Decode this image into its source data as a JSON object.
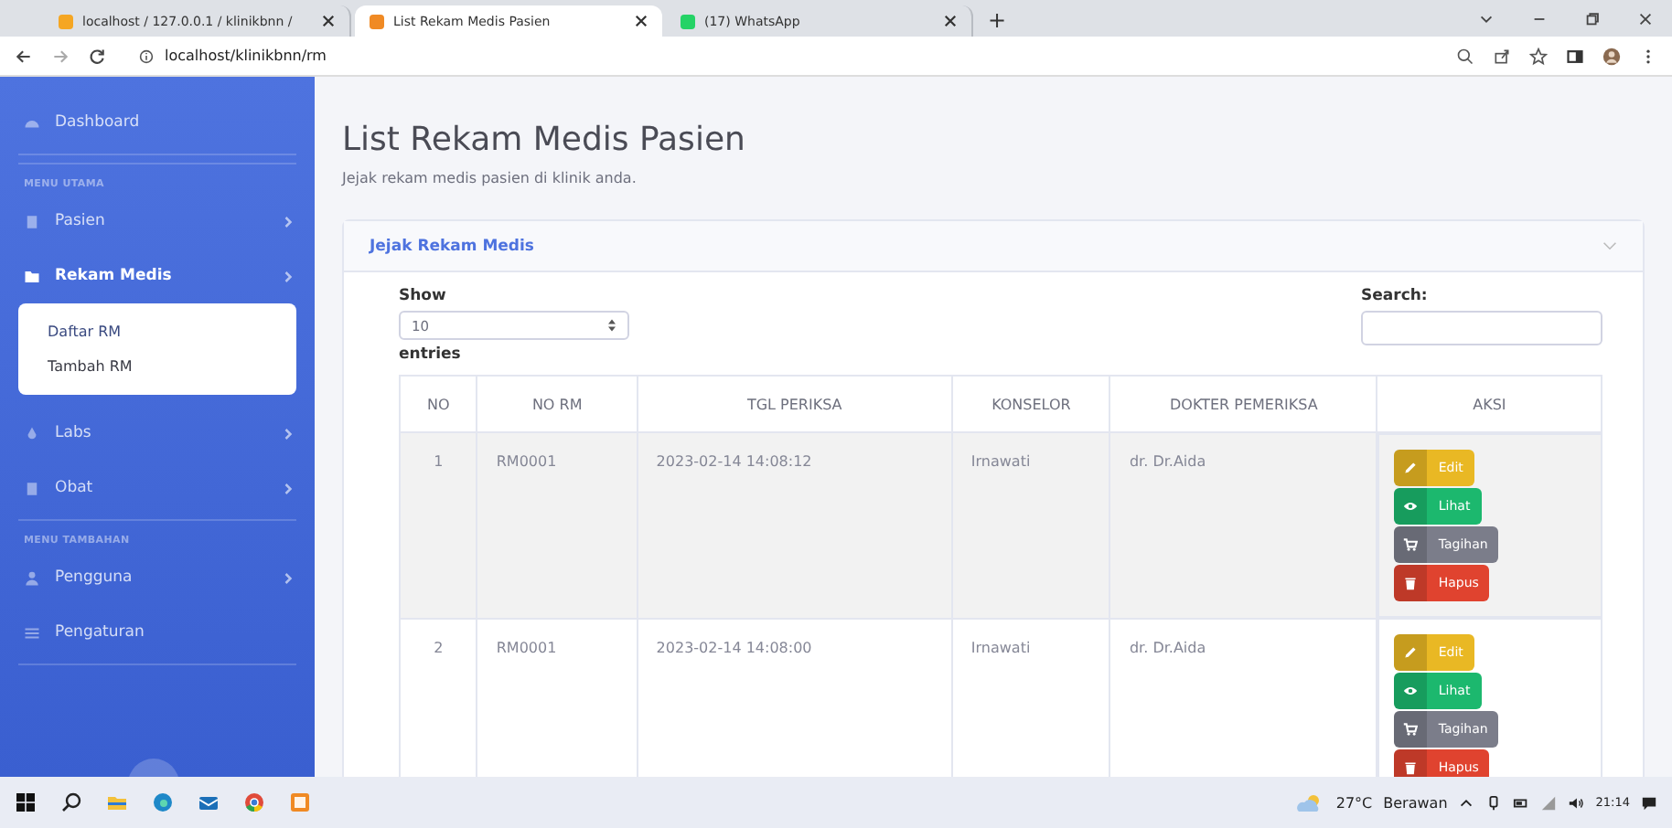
{
  "browser": {
    "tabs": [
      {
        "title": "localhost / 127.0.0.1 / klinikbnn / ",
        "selected": false
      },
      {
        "title": "List Rekam Medis Pasien",
        "selected": true
      },
      {
        "title": "(17) WhatsApp",
        "selected": false
      }
    ],
    "new_tab": "+",
    "url": "localhost/klinikbnn/rm"
  },
  "sidebar": {
    "items": [
      {
        "kind": "link",
        "label": "Dashboard",
        "selected": false,
        "arrow": false
      },
      {
        "kind": "heading",
        "label": "MENU UTAMA"
      },
      {
        "kind": "link",
        "label": "Pasien",
        "selected": false,
        "arrow": true
      },
      {
        "kind": "link",
        "label": "Rekam Medis",
        "selected": true,
        "arrow": true,
        "expanded": true,
        "children": [
          {
            "label": "Daftar RM",
            "selected": true
          },
          {
            "label": "Tambah RM",
            "selected": false
          }
        ]
      },
      {
        "kind": "link",
        "label": "Labs",
        "selected": false,
        "arrow": true
      },
      {
        "kind": "link",
        "label": "Obat",
        "selected": false,
        "arrow": true
      },
      {
        "kind": "heading",
        "label": "MENU TAMBAHAN"
      },
      {
        "kind": "link",
        "label": "Pengguna",
        "selected": false,
        "arrow": true
      },
      {
        "kind": "link",
        "label": "Pengaturan",
        "selected": false,
        "arrow": false
      }
    ]
  },
  "page": {
    "title": "List Rekam Medis Pasien",
    "subtitle": "Jejak rekam medis pasien di klinik anda."
  },
  "card": {
    "title": "Jejak Rekam Medis",
    "show_label": "Show",
    "page_size": "10",
    "entries_label": "entries",
    "search_label": "Search:",
    "table": {
      "columns": [
        "NO",
        "NO RM",
        "TGL PERIKSA",
        "KONSELOR",
        "DOKTER PEMERIKSA",
        "AKSI"
      ],
      "rows": [
        {
          "cells": [
            "1",
            "RM0001",
            "2023-02-14 14:08:12",
            "Irnawati",
            "dr. Dr.Aida"
          ],
          "striped": true,
          "actions": [
            {
              "kind": "edit",
              "label": "Edit"
            },
            {
              "kind": "view",
              "label": "Lihat"
            },
            {
              "kind": "bill",
              "label": "Tagihan"
            },
            {
              "kind": "delete",
              "label": "Hapus"
            }
          ]
        },
        {
          "cells": [
            "2",
            "RM0001",
            "2023-02-14 14:08:00",
            "Irnawati",
            "dr. Dr.Aida"
          ],
          "striped": false,
          "actions": [
            {
              "kind": "edit",
              "label": "Edit"
            },
            {
              "kind": "view",
              "label": "Lihat"
            },
            {
              "kind": "bill",
              "label": "Tagihan"
            },
            {
              "kind": "delete",
              "label": "Hapus"
            }
          ]
        }
      ]
    }
  },
  "taskbar": {
    "temperature": "27°C",
    "weather": "Berawan",
    "time": "21:14"
  }
}
